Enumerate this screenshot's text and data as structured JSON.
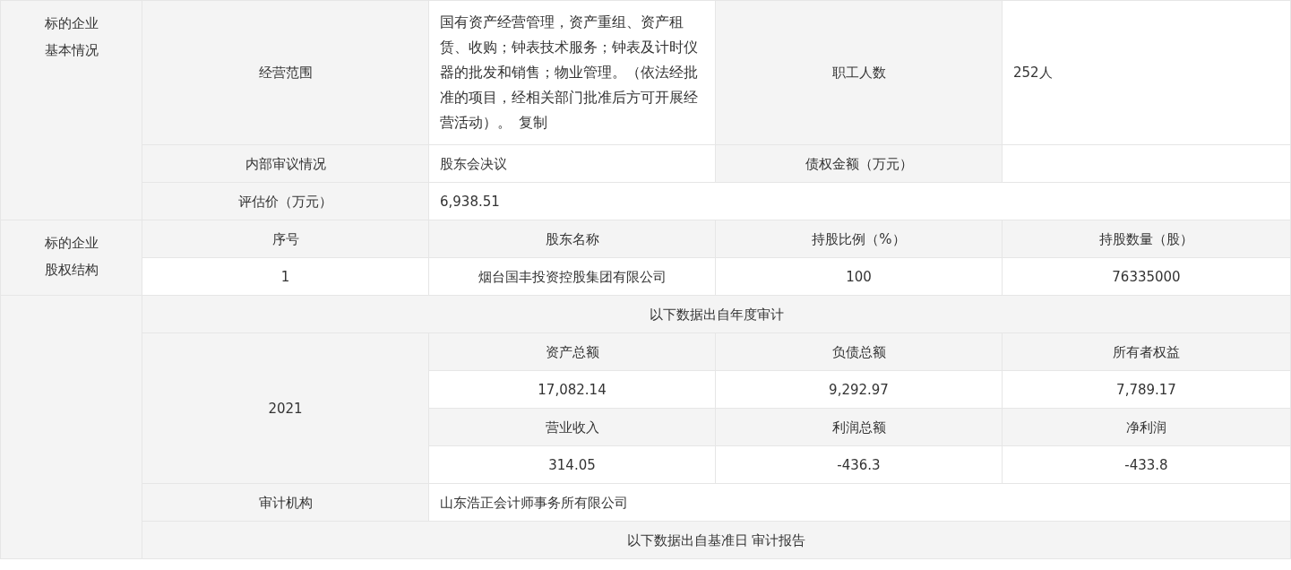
{
  "basic_info": {
    "label": "标的企业基本情况",
    "business_scope": {
      "label": "经营范围",
      "value": "国有资产经营管理，资产重组、资产租赁、收购；钟表技术服务；钟表及计时仪器的批发和销售；物业管理。（依法经批准的项目，经相关部门批准后方可开展经营活动）。",
      "copy_link": "复制"
    },
    "employees": {
      "label": "职工人数",
      "value": "252人"
    },
    "internal_review": {
      "label": "内部审议情况",
      "value": "股东会决议"
    },
    "claim_amount": {
      "label": "债权金额（万元）"
    },
    "valuation": {
      "label": "评估价（万元）",
      "value": "6,938.51"
    }
  },
  "equity_structure": {
    "label": "标的企业股权结构",
    "columns": [
      "序号",
      "股东名称",
      "持股比例（%）",
      "持股数量（股）"
    ],
    "rows": [
      [
        "1",
        "烟台国丰投资控股集团有限公司",
        "100",
        "76335000"
      ]
    ]
  },
  "financials": {
    "annual_heading": "以下数据出自年度审计",
    "year": "2021",
    "groups": [
      {
        "headers": [
          "资产总额",
          "负债总额",
          "所有者权益"
        ],
        "values": [
          "17,082.14",
          "9,292.97",
          "7,789.17"
        ]
      },
      {
        "headers": [
          "营业收入",
          "利润总额",
          "净利润"
        ],
        "values": [
          "314.05",
          "-436.3",
          "-433.8"
        ]
      }
    ],
    "auditor": {
      "label": "审计机构",
      "value": "山东浩正会计师事务所有限公司"
    },
    "base_date_heading": "以下数据出自基准日 审计报告"
  }
}
